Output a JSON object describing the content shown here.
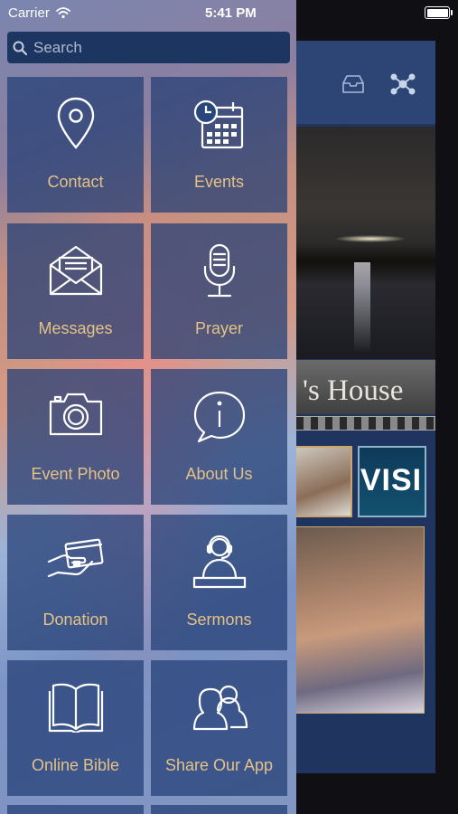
{
  "status_bar": {
    "carrier": "Carrier",
    "time": "5:41 PM"
  },
  "search": {
    "placeholder": "Search"
  },
  "menu": {
    "items": [
      {
        "label": "Contact",
        "icon": "location-pin-icon"
      },
      {
        "label": "Events",
        "icon": "calendar-clock-icon"
      },
      {
        "label": "Messages",
        "icon": "envelope-icon"
      },
      {
        "label": "Prayer",
        "icon": "microphone-icon"
      },
      {
        "label": "Event Photo",
        "icon": "camera-icon"
      },
      {
        "label": "About Us",
        "icon": "info-bubble-icon"
      },
      {
        "label": "Donation",
        "icon": "hand-card-icon"
      },
      {
        "label": "Sermons",
        "icon": "headset-person-icon"
      },
      {
        "label": "Online Bible",
        "icon": "open-book-icon"
      },
      {
        "label": "Share Our App",
        "icon": "people-icon"
      }
    ]
  },
  "background_app": {
    "banner_text": "'s House",
    "thumb_text": "VISI"
  },
  "colors": {
    "accent_label": "#e4c287",
    "tile_bg": "#244076",
    "search_bg": "#1d3661"
  }
}
